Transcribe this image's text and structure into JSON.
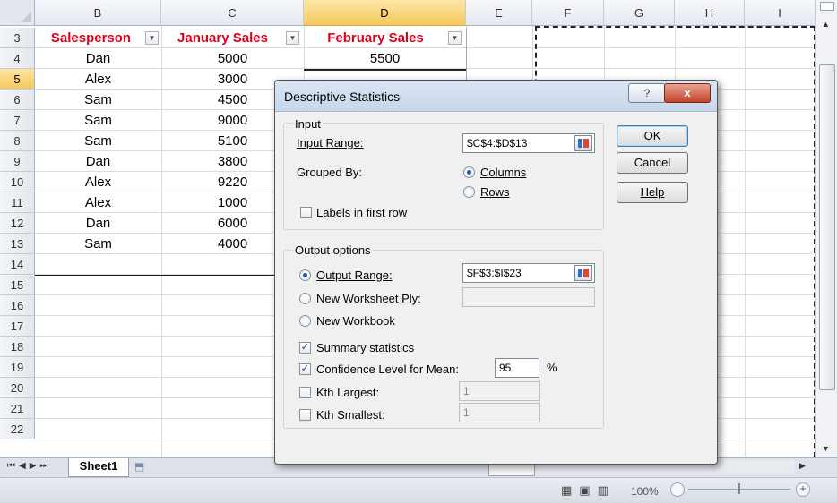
{
  "columns": [
    "B",
    "C",
    "D",
    "E",
    "F",
    "G",
    "H",
    "I"
  ],
  "rows": [
    "3",
    "4",
    "5",
    "6",
    "7",
    "8",
    "9",
    "10",
    "11",
    "12",
    "13",
    "14",
    "15",
    "16",
    "17",
    "18",
    "19",
    "20",
    "21",
    "22"
  ],
  "table": {
    "headers": [
      "Salesperson",
      "January Sales",
      "February Sales"
    ],
    "data": [
      [
        "Dan",
        "5000",
        "5500"
      ],
      [
        "Alex",
        "3000",
        ""
      ],
      [
        "Sam",
        "4500",
        ""
      ],
      [
        "Sam",
        "9000",
        ""
      ],
      [
        "Sam",
        "5100",
        ""
      ],
      [
        "Dan",
        "3800",
        ""
      ],
      [
        "Alex",
        "9220",
        ""
      ],
      [
        "Alex",
        "1000",
        ""
      ],
      [
        "Dan",
        "6000",
        ""
      ],
      [
        "Sam",
        "4000",
        ""
      ]
    ]
  },
  "sheet_tab": "Sheet1",
  "status": {
    "zoom": "100%"
  },
  "dialog": {
    "title": "Descriptive Statistics",
    "help_glyph": "?",
    "close_glyph": "x",
    "input_group": "Input",
    "input_range_label": "Input Range:",
    "input_range_value": "$C$4:$D$13",
    "grouped_by_label": "Grouped By:",
    "columns_label": "Columns",
    "rows_label": "Rows",
    "labels_first_row": "Labels in first row",
    "output_group": "Output options",
    "output_range_label": "Output Range:",
    "output_range_value": "$F$3:$I$23",
    "new_ply_label": "New Worksheet Ply:",
    "new_workbook_label": "New Workbook",
    "summary_stats": "Summary statistics",
    "confidence_label": "Confidence Level for Mean:",
    "confidence_value": "95",
    "percent": "%",
    "kth_largest": "Kth Largest:",
    "kth_largest_value": "1",
    "kth_smallest": "Kth Smallest:",
    "kth_smallest_value": "1",
    "ok": "OK",
    "cancel": "Cancel",
    "help": "Help"
  }
}
